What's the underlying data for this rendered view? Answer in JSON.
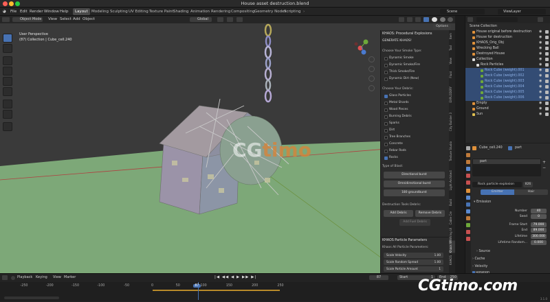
{
  "window": {
    "title": "House asset destruction.blend"
  },
  "menu": {
    "app_logo": "blender-logo",
    "items": [
      "File",
      "Edit",
      "Render",
      "Window",
      "Help"
    ]
  },
  "workspaces": [
    "Layout",
    "Modeling",
    "Sculpting",
    "UV Editing",
    "Texture Paint",
    "Shading",
    "Animation",
    "Rendering",
    "Compositing",
    "Geometry Nodes",
    "Scripting"
  ],
  "scene": {
    "scene_name": "Scene",
    "view_layer": "ViewLayer"
  },
  "viewport_header": {
    "mode": "Object Mode",
    "menus": [
      "View",
      "Select",
      "Add",
      "Object"
    ],
    "orientation": "Global",
    "options": "Options"
  },
  "viewport": {
    "view_name": "User Perspective",
    "collection_info": "(87) Collection | Cube_cell.240"
  },
  "watermark": {
    "center_a": "CG",
    "center_b": "timo",
    "corner": "CGtimo.com"
  },
  "khaos": {
    "title": "KHAOS: Procedural Explosions",
    "generate": "GENERATE KHAOS!",
    "smoke_heading": "Choose Your Smoke Type:",
    "smoke_options": [
      {
        "label": "Dynamic Smoke",
        "checked": false
      },
      {
        "label": "Dynamic Smoke/Fire",
        "checked": false
      },
      {
        "label": "Thick Smoke/Fire",
        "checked": false
      },
      {
        "label": "Dynamic Dirt (New)",
        "checked": false
      }
    ],
    "debris_heading": "Choose Your Debris:",
    "debris_options": [
      {
        "label": "Glass Particles",
        "checked": true
      },
      {
        "label": "Metal Shards",
        "checked": false
      },
      {
        "label": "Wood Pieces",
        "checked": false
      },
      {
        "label": "Burning Debris",
        "checked": false
      },
      {
        "label": "Sparks",
        "checked": false
      },
      {
        "label": "Dirt",
        "checked": false
      },
      {
        "label": "Tree Branches",
        "checked": false
      },
      {
        "label": "Concrete",
        "checked": false
      },
      {
        "label": "Rebar Rods",
        "checked": false
      },
      {
        "label": "Rocks",
        "checked": true
      }
    ],
    "blast_heading": "Type of Blast:",
    "blast_buttons": [
      "Directional burst",
      "Omnidirectional burst",
      "180 groundburst"
    ],
    "tools_heading": "Destruction Tools Debris:",
    "add_debris": "Add Debris",
    "remove_debris": "Remove Debris",
    "add_fuel": "Add Fuel Debris",
    "particle_title": "KHAOS Particle Parameters",
    "particle_subtitle": "Khaos All Particle Parameters:",
    "params": [
      {
        "label": "Scale Velocity",
        "value": "1.00"
      },
      {
        "label": "Scale Random Spread",
        "value": "1.00"
      },
      {
        "label": "Scale Particle Amount",
        "value": "1"
      }
    ]
  },
  "side_tabs": [
    "Item",
    "Tool",
    "View",
    "Fluid",
    "EXPLODERY",
    "City Builder 3",
    "Texture Studio",
    "Light Architect",
    "Build",
    "Cable Cre",
    "Wiring Ui",
    "Khaos Wl",
    "KHAOS"
  ],
  "outliner": {
    "root": "Scene Collection",
    "rows": [
      {
        "label": "House original before destruction",
        "indent": 1,
        "selected": false
      },
      {
        "label": "House for destruction",
        "indent": 1,
        "selected": false
      },
      {
        "label": "KHAOS_Orig_Obj",
        "indent": 1,
        "selected": false
      },
      {
        "label": "Wrecking Ball",
        "indent": 1,
        "selected": false
      },
      {
        "label": "Destroyed House",
        "indent": 1,
        "selected": false
      },
      {
        "label": "Collection",
        "indent": 1,
        "selected": false
      },
      {
        "label": "Rock Particles",
        "indent": 2,
        "selected": false
      },
      {
        "label": "Rock Cube (weight).001",
        "indent": 3,
        "selected": true
      },
      {
        "label": "Rock Cube (weight).002",
        "indent": 3,
        "selected": true
      },
      {
        "label": "Rock Cube (weight).003",
        "indent": 3,
        "selected": true
      },
      {
        "label": "Rock Cube (weight).004",
        "indent": 3,
        "selected": true
      },
      {
        "label": "Rock Cube (weight).005",
        "indent": 3,
        "selected": true
      },
      {
        "label": "Rock Cube (weight).006",
        "indent": 3,
        "selected": true
      },
      {
        "label": "Empty",
        "indent": 1,
        "selected": false
      },
      {
        "label": "Ground",
        "indent": 1,
        "selected": false
      },
      {
        "label": "Sun",
        "indent": 1,
        "selected": false
      }
    ]
  },
  "properties": {
    "object": "Cube_cell.240",
    "modifier": "part",
    "system": "part",
    "settings_name": "Rock particle explosion",
    "users": "826",
    "type_tabs": [
      "Emitter",
      "Hair"
    ],
    "emission_label": "Emission",
    "fields": [
      {
        "label": "Number",
        "value": "40"
      },
      {
        "label": "Seed",
        "value": "0"
      },
      {
        "label": "Frame Start",
        "value": "79.000"
      },
      {
        "label": "End",
        "value": "89.000"
      },
      {
        "label": "Lifetime",
        "value": "300.000"
      },
      {
        "label": "Lifetime Random...",
        "value": "0.000"
      }
    ],
    "subpanels": [
      "Source",
      "Cache",
      "Velocity",
      "Rotation",
      "Physics"
    ]
  },
  "timeline": {
    "menus": [
      "Playback",
      "Keying",
      "View",
      "Marker"
    ],
    "current_frame": "87",
    "start_label": "Start",
    "start": "1",
    "end_label": "End",
    "end": "250",
    "ticks": [
      "-250",
      "-200",
      "-150",
      "-100",
      "-50",
      "0",
      "50",
      "87",
      "100",
      "150",
      "200",
      "250"
    ],
    "version": "3.1.0"
  },
  "colors": {
    "accent": "#4772b3",
    "selected_row": "#334c74",
    "ground": "#7da878",
    "bg": "#3a3a3a"
  }
}
